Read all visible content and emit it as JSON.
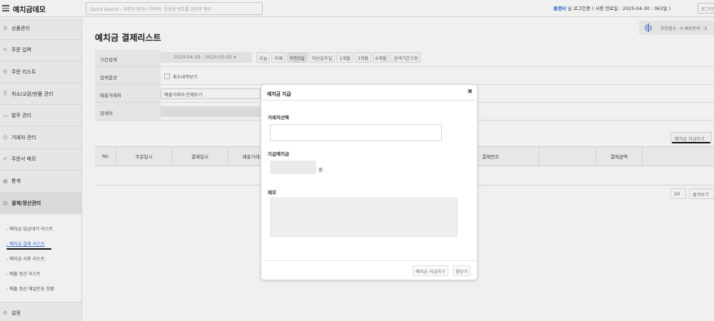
{
  "app": {
    "title": "예치금데모"
  },
  "search": {
    "placeholder": "Quick Search : 주문자 명이나 연락처, 운송장 번호를 입력후 엔터"
  },
  "login": {
    "user": "플랜비",
    "text": " 님 로그인중 ( 사용 만료일 : 2025-04-30 : 363일 )",
    "logout": "로그아웃"
  },
  "sidebar": {
    "menu": [
      {
        "label": "상품관리",
        "icon": "gear-icon"
      },
      {
        "label": "주문 입력",
        "icon": "edit-icon"
      },
      {
        "label": "주문 리스트",
        "icon": "list-icon"
      },
      {
        "label": "취소/교환/반품 관리",
        "icon": "return-icon"
      },
      {
        "label": "발주 관리",
        "icon": "order-icon"
      },
      {
        "label": "거래처 관리",
        "icon": "person-icon"
      },
      {
        "label": "주문서 메모",
        "icon": "memo-icon"
      },
      {
        "label": "통계",
        "icon": "chart-icon"
      },
      {
        "label": "결제/정산관리",
        "icon": "calculator-icon"
      }
    ],
    "submenu": [
      "- 예치금 입금대기 리스트",
      "- 예치금 결제 리스트",
      "- 예치금 사용 리스트",
      "- 매출 정산 리스트",
      "- 매출 정산 메일전송 현황"
    ],
    "settings": {
      "label": "설정",
      "icon": "gear-icon"
    }
  },
  "page": {
    "title": "예치금 결제리스트"
  },
  "status": {
    "text": "주문접수 : 0   배송준비 : 0"
  },
  "filter": {
    "period_label": "기간검색",
    "date_range": "2024-04-29 - 2024-05-02",
    "quick": [
      "오늘",
      "어제",
      "이전3일",
      "지난일주일",
      "1개월",
      "3개월",
      "6개월",
      "검색기간고정"
    ],
    "option_label": "검색옵션",
    "option_check": "취소내역보기",
    "vendor_label": "매출거래처",
    "vendor_value": "매출거래처:전체보기",
    "keyword_label": "검색어"
  },
  "actions": {
    "payout": "예치금 지급하기"
  },
  "table": {
    "columns": [
      "No",
      "주문일시",
      "결제일시",
      "매출거래처",
      "",
      "",
      "",
      "결제번호",
      "",
      "결제금액",
      ""
    ]
  },
  "pagination": {
    "size": "20",
    "button": "줄씩보기"
  },
  "modal": {
    "title": "예치금 지급",
    "vendor_label": "거래처선택",
    "amount_label": "지급예치금",
    "won": "원",
    "memo_label": "메모",
    "submit": "예치금 지급하기",
    "close": "창닫기"
  }
}
